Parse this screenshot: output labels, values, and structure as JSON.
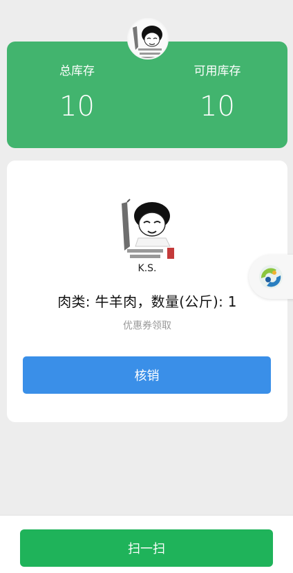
{
  "stats": {
    "total_label": "总库存",
    "total_value": "10",
    "available_label": "可用库存",
    "available_value": "10"
  },
  "coupon": {
    "username": "K.S.",
    "product_line": "肉类: 牛羊肉，数量(公斤): 1",
    "hint": "优惠券领取",
    "verify_label": "核销"
  },
  "bottom": {
    "scan_label": "扫一扫"
  },
  "colors": {
    "stats_green": "#42b46e",
    "verify_blue": "#3a8fe8",
    "scan_green": "#1fb35a"
  }
}
